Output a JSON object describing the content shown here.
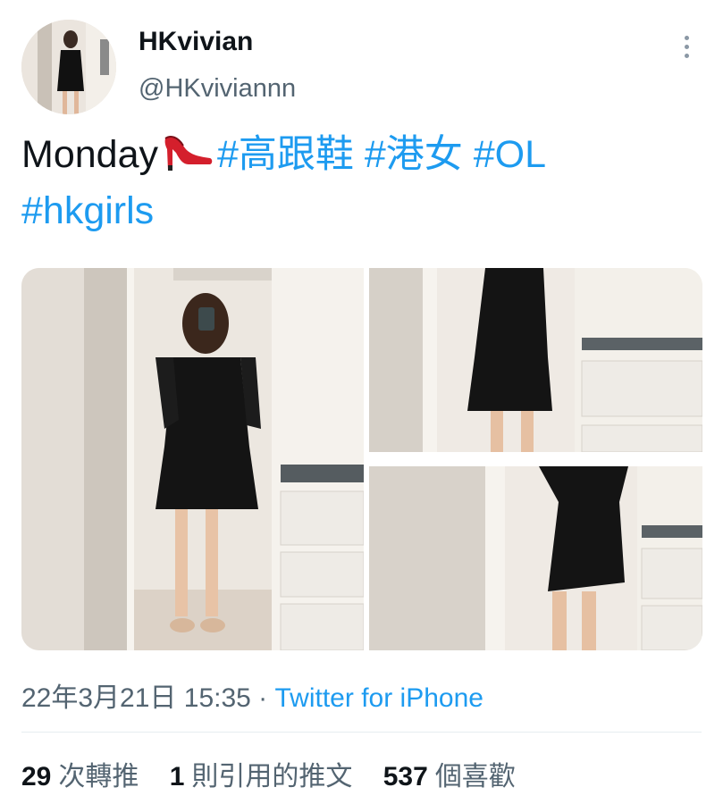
{
  "author": {
    "display_name": "HKvivian",
    "handle": "@HKviviannn",
    "avatar_icon": "avatar-photo"
  },
  "tweet": {
    "text_prefix": "Monday",
    "emoji": "high-heel-shoe",
    "hashtags": [
      "#高跟鞋",
      "#港女",
      "#OL",
      "#hkgirls"
    ]
  },
  "media": {
    "count": 3,
    "photos": [
      "mirror-selfie-black-dress",
      "dress-side-view-upper",
      "dress-side-view-lower"
    ]
  },
  "meta": {
    "timestamp": "22年3月21日 15:35",
    "separator": " · ",
    "source": "Twitter for iPhone"
  },
  "stats": {
    "retweets_count": "29",
    "retweets_label": "次轉推",
    "quotes_count": "1",
    "quotes_label": "則引用的推文",
    "likes_count": "537",
    "likes_label": "個喜歡"
  },
  "colors": {
    "link": "#1d9bf0",
    "secondary_text": "#536471",
    "primary_text": "#0f1419"
  }
}
